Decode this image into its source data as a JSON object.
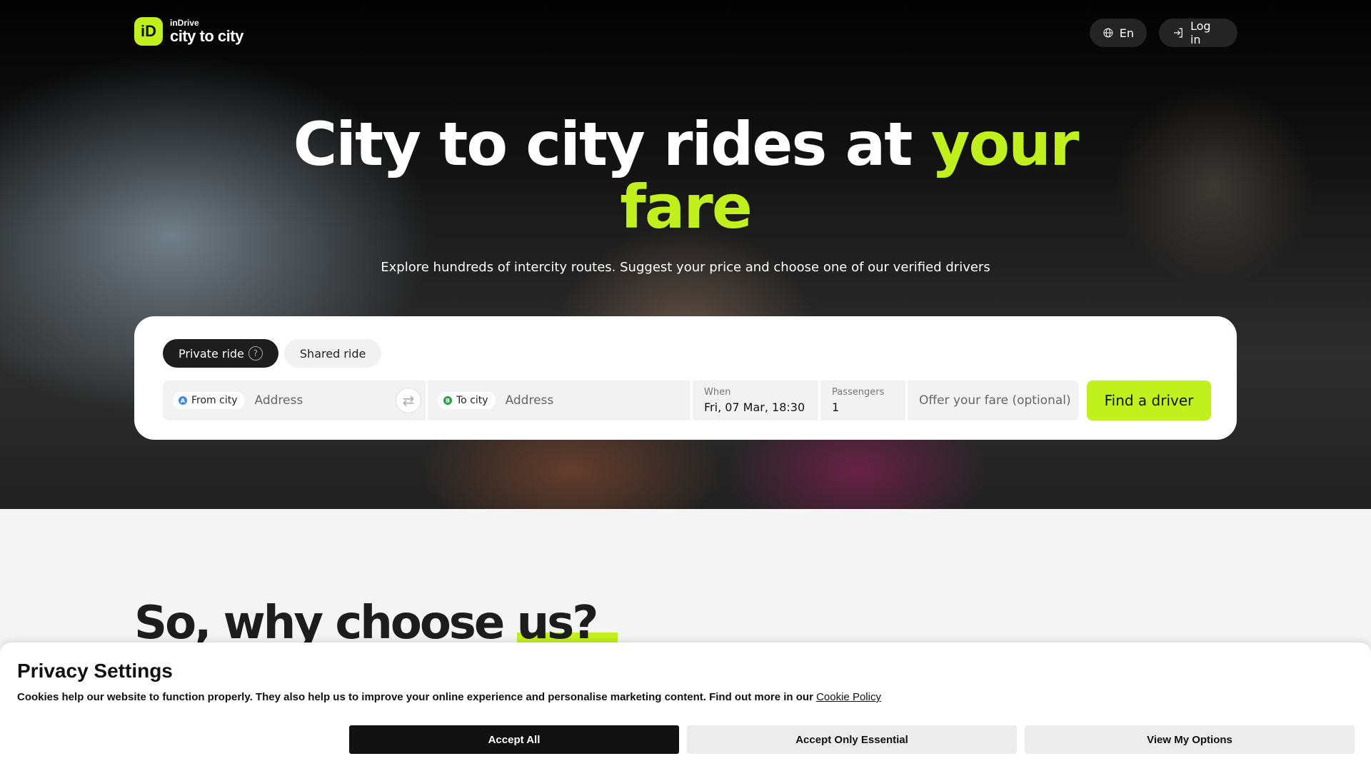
{
  "brand": {
    "small": "inDrive",
    "big": "city to city",
    "mark": "iD",
    "accent_color": "#c1f11d"
  },
  "header": {
    "language_label": "En",
    "login_label": "Log in"
  },
  "hero": {
    "title_main": "City to city rides at ",
    "title_accent_1": "your",
    "title_accent_2": "fare",
    "subtitle": "Explore hundreds of intercity routes. Suggest your price and choose one of our verified drivers"
  },
  "search": {
    "tabs": [
      {
        "label": "Private ride",
        "active": true
      },
      {
        "label": "Shared ride",
        "active": false
      }
    ],
    "from_chip": "From city",
    "from_placeholder": "Address",
    "to_chip": "To city",
    "to_placeholder": "Address",
    "when_label": "When",
    "when_value": "Fri, 07 Mar, 18:30",
    "passengers_label": "Passengers",
    "passengers_value": "1",
    "fare_placeholder": "Offer your fare (optional)",
    "find_button": "Find a driver"
  },
  "section": {
    "title_main": "So, why choose ",
    "title_highlight": "us?"
  },
  "cookie": {
    "title": "Privacy Settings",
    "text": "Cookies help our website to function properly. They also help us to improve your online experience and personalise marketing content. Find out more in our ",
    "link": "Cookie Policy",
    "accept_all": "Accept All",
    "accept_essential": "Accept Only Essential",
    "view_options": "View My Options"
  }
}
